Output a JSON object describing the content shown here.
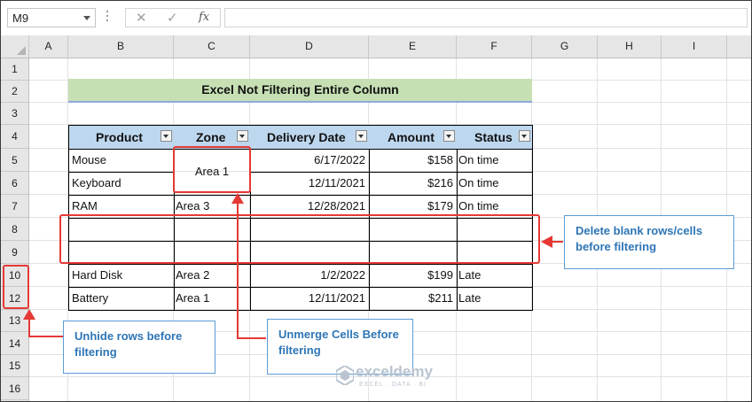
{
  "formula_bar": {
    "name_box": "M9",
    "cancel_glyph": "✕",
    "enter_glyph": "✓",
    "fx_label": "fx",
    "formula": ""
  },
  "columns": [
    "A",
    "B",
    "C",
    "D",
    "E",
    "F",
    "G",
    "H",
    "I"
  ],
  "rows": [
    "1",
    "2",
    "3",
    "4",
    "5",
    "6",
    "7",
    "8",
    "9",
    "10",
    "12",
    "13",
    "14",
    "15",
    "16"
  ],
  "sheet": {
    "title": "Excel Not Filtering Entire Column",
    "table": {
      "headers": [
        "Product",
        "Zone",
        "Delivery Date",
        "Amount",
        "Status"
      ],
      "rows": [
        {
          "product": "Mouse",
          "zone": "",
          "date": "6/17/2022",
          "amount": "$158",
          "status": "On time"
        },
        {
          "product": "Keyboard",
          "zone": "",
          "date": "12/11/2021",
          "amount": "$216",
          "status": "On time"
        },
        {
          "product": "RAM",
          "zone": "Area 3",
          "date": "12/28/2021",
          "amount": "$179",
          "status": "On time"
        },
        {
          "product": "",
          "zone": "",
          "date": "",
          "amount": "",
          "status": ""
        },
        {
          "product": "",
          "zone": "",
          "date": "",
          "amount": "",
          "status": ""
        },
        {
          "product": "Hard Disk",
          "zone": "Area 2",
          "date": "1/2/2022",
          "amount": "$199",
          "status": "Late"
        },
        {
          "product": "Battery",
          "zone": "Area 1",
          "date": "12/11/2021",
          "amount": "$211",
          "status": "Late"
        }
      ],
      "merged_zone": "Area 1"
    }
  },
  "callouts": {
    "blank_rows": "Delete blank rows/cells before filtering",
    "unhide_rows": "Unhide rows before filtering",
    "unmerge": "Unmerge Cells Before filtering"
  },
  "watermark": {
    "name": "exceldemy",
    "tagline": "EXCEL · DATA · BI"
  },
  "colors": {
    "header_fill": "#bdd7ee",
    "title_fill": "#c6e0b4",
    "annotation_red": "#e53935",
    "callout_blue": "#2e75b6"
  },
  "icons": [
    "name-box-dropdown-icon",
    "cancel-icon",
    "enter-icon",
    "function-icon",
    "filter-dropdown-icon",
    "exceldemy-logo-icon"
  ]
}
